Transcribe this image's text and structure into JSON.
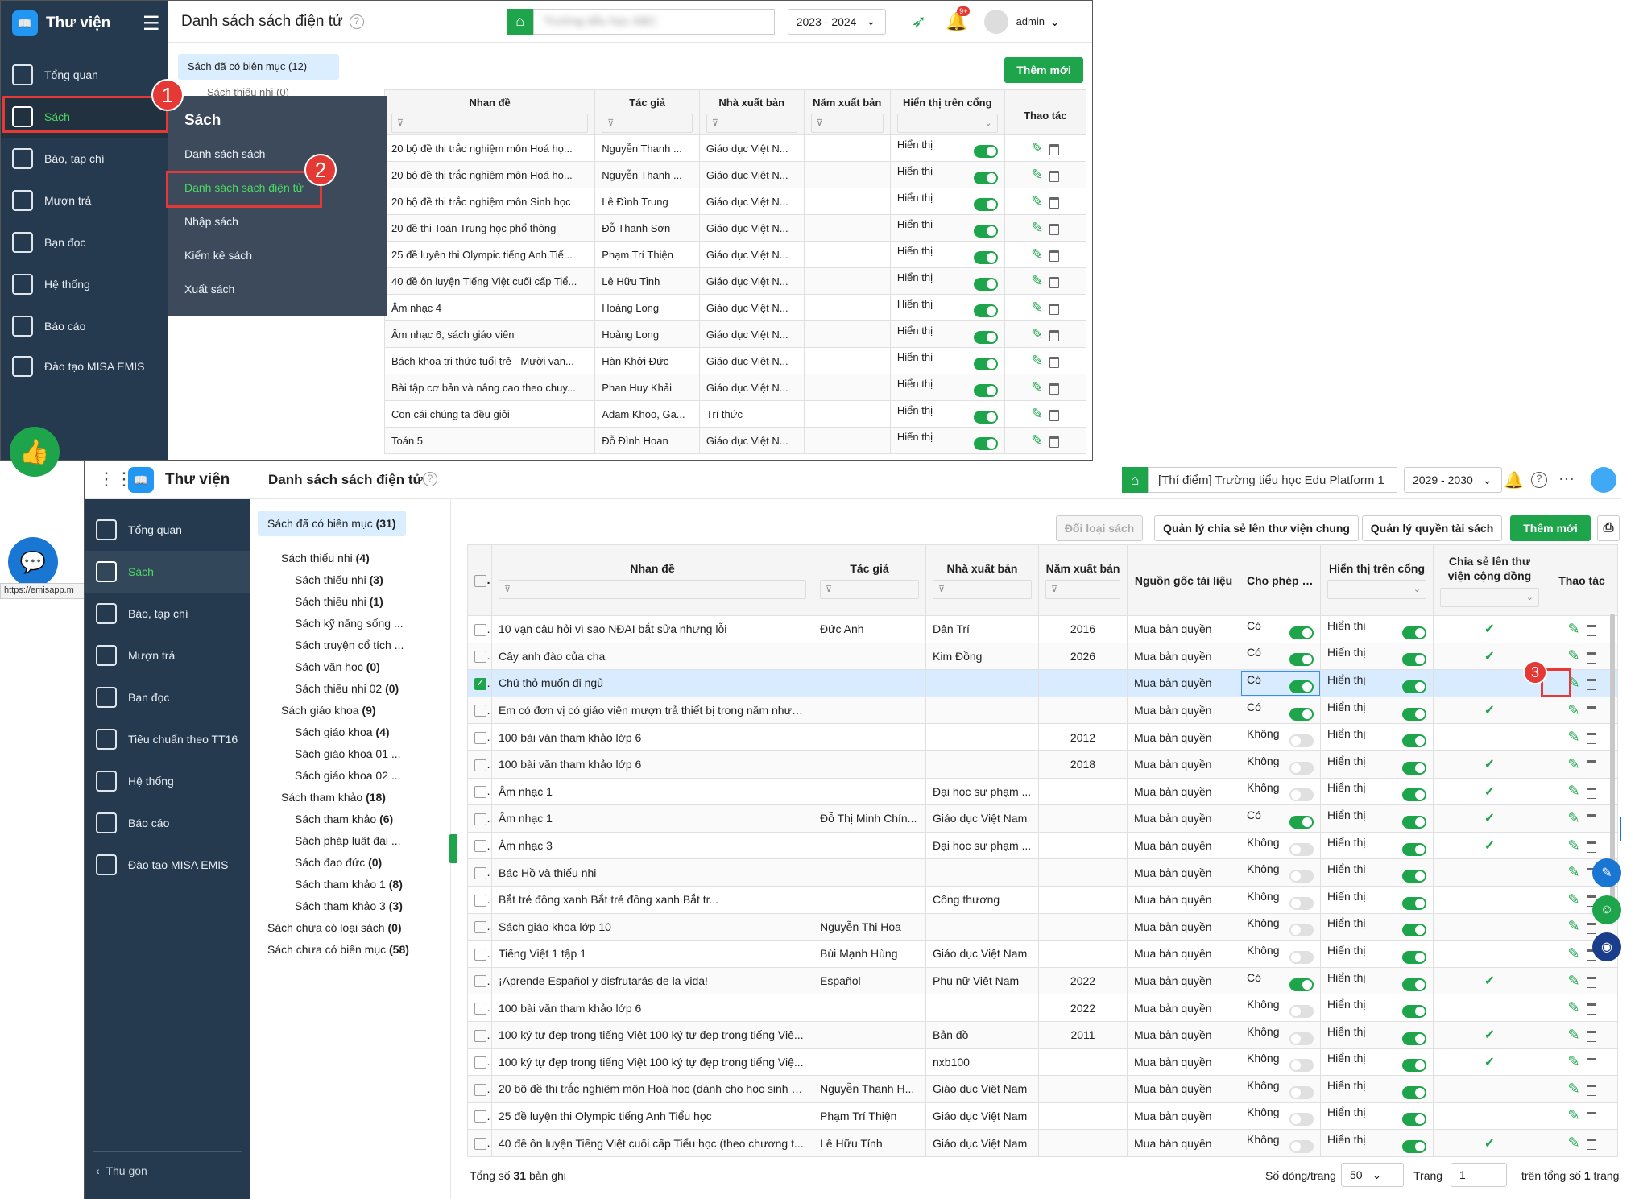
{
  "top": {
    "brand": "Thư viện",
    "page_title": "Danh sách sách điện tử",
    "year": "2023 - 2024",
    "notif_count": "9+",
    "user": "admin",
    "school_blurred": "Trường tiểu học ABC",
    "nav": [
      "Tổng quan",
      "Sách",
      "Báo, tạp chí",
      "Mượn trả",
      "Bạn đọc",
      "Hệ thống",
      "Báo cáo",
      "Đào tạo MISA EMIS"
    ],
    "flyout": {
      "header": "Sách",
      "items": [
        "Danh sách sách",
        "Danh sách sách điện tử",
        "Nhập sách",
        "Kiểm kê sách",
        "Xuất sách"
      ]
    },
    "tree_sel": "Sách đã có biên mục (12)",
    "tree_next": "Sách thiếu nhi (0)",
    "add_button": "Thêm mới",
    "columns": [
      "Nhan đề",
      "Tác giả",
      "Nhà xuất bản",
      "Năm xuất bản",
      "Hiển thị trên cổng",
      "Thao tác"
    ],
    "rows": [
      [
        "20 bộ đề thi trắc nghiệm môn Hoá họ...",
        "Nguyễn Thanh ...",
        "Giáo dục Việt N...",
        "",
        "Hiển thị"
      ],
      [
        "20 bộ đề thi trắc nghiệm môn Hoá họ...",
        "Nguyễn Thanh ...",
        "Giáo dục Việt N...",
        "",
        "Hiển thị"
      ],
      [
        "20 bộ đề thi trắc nghiệm môn Sinh học",
        "Lê Đình Trung",
        "Giáo dục Việt N...",
        "",
        "Hiển thị"
      ],
      [
        "20 đề thi Toán Trung học phổ thông",
        "Đỗ Thanh Sơn",
        "Giáo dục Việt N...",
        "",
        "Hiển thị"
      ],
      [
        "25 đề luyện thi Olympic tiếng Anh Tiể...",
        "Phạm Trí Thiện",
        "Giáo dục Việt N...",
        "",
        "Hiển thị"
      ],
      [
        "40 đề ôn luyện Tiếng Việt cuối cấp Tiể...",
        "Lê Hữu Tỉnh",
        "Giáo dục Việt N...",
        "",
        "Hiển thị"
      ],
      [
        "Âm nhạc 4",
        "Hoàng Long",
        "Giáo dục Việt N...",
        "",
        "Hiển thị"
      ],
      [
        "Âm nhạc 6, sách giáo viên",
        "Hoàng Long",
        "Giáo dục Việt N...",
        "",
        "Hiển thị"
      ],
      [
        "Bách khoa tri thức tuổi trẻ - Mười vạn...",
        "Hàn Khởi Đức",
        "Giáo dục Việt N...",
        "",
        "Hiển thị"
      ],
      [
        "Bài tập cơ bản và nâng cao theo chuy...",
        "Phan Huy Khải",
        "Giáo dục Việt N...",
        "",
        "Hiển thị"
      ],
      [
        "Con cái chúng ta đều giỏi",
        "Adam Khoo, Ga...",
        "Trí thức",
        "",
        "Hiển thị"
      ],
      [
        "Toán 5",
        "Đỗ Đình Hoan",
        "Giáo dục Việt N...",
        "",
        "Hiển thị"
      ]
    ],
    "url_hint": "https://emisapp.m"
  },
  "bottom": {
    "brand": "Thư viện",
    "page_title": "Danh sách sách điện tử",
    "school": "[Thí điểm] Trường tiểu học Edu Platform 1",
    "year": "2029 - 2030",
    "nav": [
      "Tổng quan",
      "Sách",
      "Báo, tạp chí",
      "Mượn trả",
      "Bạn đọc",
      "Tiêu chuẩn theo TT16",
      "Hệ thống",
      "Báo cáo",
      "Đào tạo MISA EMIS"
    ],
    "collapse": "Thu gọn",
    "tree": [
      {
        "label": "Sách đã có biên mục",
        "count": "(31)"
      },
      {
        "label": "Sách thiếu nhi",
        "count": "(4)"
      },
      {
        "label": "Sách thiếu nhi",
        "count": "(3)"
      },
      {
        "label": "Sách thiếu nhi",
        "count": "(1)"
      },
      {
        "label": "Sách kỹ năng sống ...",
        "count": ""
      },
      {
        "label": "Sách truyện cổ tích ...",
        "count": ""
      },
      {
        "label": "Sách văn học",
        "count": "(0)"
      },
      {
        "label": "Sách thiếu nhi 02",
        "count": "(0)"
      },
      {
        "label": "Sách giáo khoa",
        "count": "(9)"
      },
      {
        "label": "Sách giáo khoa",
        "count": "(4)"
      },
      {
        "label": "Sách giáo khoa 01 ...",
        "count": ""
      },
      {
        "label": "Sách giáo khoa 02 ...",
        "count": ""
      },
      {
        "label": "Sách tham khảo",
        "count": "(18)"
      },
      {
        "label": "Sách tham khảo",
        "count": "(6)"
      },
      {
        "label": "Sách pháp luật đại ...",
        "count": ""
      },
      {
        "label": "Sách đạo đức",
        "count": "(0)"
      },
      {
        "label": "Sách tham khảo 1",
        "count": "(8)"
      },
      {
        "label": "Sách tham khảo 3",
        "count": "(3)"
      },
      {
        "label": "Sách chưa có loại sách",
        "count": "(0)"
      },
      {
        "label": "Sách chưa có biên mục",
        "count": "(58)"
      }
    ],
    "buttons": {
      "change_type": "Đổi loại sách",
      "share_manage": "Quản lý chia sẻ lên thư viện chung",
      "rights_manage": "Quản lý quyền tài sách",
      "add": "Thêm mới"
    },
    "columns": [
      "Nhan đề",
      "Tác giả",
      "Nhà xuất bản",
      "Năm xuất bản",
      "Nguồn gốc tài liệu",
      "Cho phép tải",
      "Hiển thị trên cổng",
      "Chia sẻ lên thư viện cộng đồng",
      "Thao tác"
    ],
    "rows": [
      {
        "title": "10 vạn câu hỏi vì sao NĐAI bắt sửa nhưng lỗi",
        "author": "Đức Anh",
        "pub": "Dân Trí",
        "year": "2016",
        "src": "Mua bản quyền",
        "dl": "Có",
        "dl_on": true,
        "show": "Hiển thị",
        "share": true,
        "checked": false
      },
      {
        "title": "Cây anh đào của cha",
        "author": "",
        "pub": "Kim Đồng",
        "year": "2026",
        "src": "Mua bản quyền",
        "dl": "Có",
        "dl_on": true,
        "show": "Hiển thị",
        "share": true,
        "checked": false
      },
      {
        "title": "Chú thỏ muốn đi ngủ",
        "author": "",
        "pub": "",
        "year": "",
        "src": "Mua bản quyền",
        "dl": "Có",
        "dl_on": true,
        "show": "Hiển thị",
        "share": false,
        "checked": true
      },
      {
        "title": "Em có đơn vị có giáo viên mượn trả thiết bị trong năm nhưng...",
        "author": "",
        "pub": "",
        "year": "",
        "src": "Mua bản quyền",
        "dl": "Có",
        "dl_on": true,
        "show": "Hiển thị",
        "share": true,
        "checked": false
      },
      {
        "title": "100 bài văn tham khảo lớp 6",
        "author": "",
        "pub": "",
        "year": "2012",
        "src": "Mua bản quyền",
        "dl": "Không",
        "dl_on": false,
        "show": "Hiển thị",
        "share": false,
        "checked": false
      },
      {
        "title": "100 bài văn tham khảo lớp 6",
        "author": "",
        "pub": "",
        "year": "2018",
        "src": "Mua bản quyền",
        "dl": "Không",
        "dl_on": false,
        "show": "Hiển thị",
        "share": true,
        "checked": false
      },
      {
        "title": "Âm nhạc 1",
        "author": "",
        "pub": "Đại học sư phạm ...",
        "year": "",
        "src": "Mua bản quyền",
        "dl": "Không",
        "dl_on": false,
        "show": "Hiển thị",
        "share": true,
        "checked": false
      },
      {
        "title": "Âm nhạc 1",
        "author": "Đỗ Thị Minh Chín...",
        "pub": "Giáo dục Việt Nam",
        "year": "",
        "src": "Mua bản quyền",
        "dl": "Có",
        "dl_on": true,
        "show": "Hiển thị",
        "share": true,
        "checked": false
      },
      {
        "title": "Âm nhạc 3",
        "author": "",
        "pub": "Đại học sư phạm ...",
        "year": "",
        "src": "Mua bản quyền",
        "dl": "Không",
        "dl_on": false,
        "show": "Hiển thị",
        "share": true,
        "checked": false
      },
      {
        "title": "Bác Hồ và thiếu nhi",
        "author": "",
        "pub": "",
        "year": "",
        "src": "Mua bản quyền",
        "dl": "Không",
        "dl_on": false,
        "show": "Hiển thị",
        "share": false,
        "checked": false
      },
      {
        "title": "Bắt trẻ đồng xanh Bắt trẻ đồng xanh Bắt tr...",
        "author": "",
        "pub": "Công thương",
        "year": "",
        "src": "Mua bản quyền",
        "dl": "Không",
        "dl_on": false,
        "show": "Hiển thị",
        "share": false,
        "checked": false
      },
      {
        "title": "Sách giáo khoa lớp 10",
        "author": "Nguyễn Thị Hoa",
        "pub": "",
        "year": "",
        "src": "Mua bản quyền",
        "dl": "Không",
        "dl_on": false,
        "show": "Hiển thị",
        "share": false,
        "checked": false
      },
      {
        "title": "Tiếng Việt 1 tập 1",
        "author": "Bùi Mạnh Hùng",
        "pub": "Giáo dục Việt Nam",
        "year": "",
        "src": "Mua bản quyền",
        "dl": "Không",
        "dl_on": false,
        "show": "Hiển thị",
        "share": false,
        "checked": false
      },
      {
        "title": "¡Aprende Español y disfrutarás de la vida!",
        "author": "Español",
        "pub": "Phụ nữ Việt Nam",
        "year": "2022",
        "src": "Mua bản quyền",
        "dl": "Có",
        "dl_on": true,
        "show": "Hiển thị",
        "share": true,
        "checked": false
      },
      {
        "title": "100 bài văn tham khảo lớp 6",
        "author": "",
        "pub": "",
        "year": "2022",
        "src": "Mua bản quyền",
        "dl": "Không",
        "dl_on": false,
        "show": "Hiển thị",
        "share": false,
        "checked": false
      },
      {
        "title": "100 ký tự đẹp trong tiếng Việt 100 ký tự đẹp trong tiếng Việ...",
        "author": "",
        "pub": "Bản đồ",
        "year": "2011",
        "src": "Mua bản quyền",
        "dl": "Không",
        "dl_on": false,
        "show": "Hiển thị",
        "share": true,
        "checked": false
      },
      {
        "title": "100 ký tự đẹp trong tiếng Việt 100 ký tự đẹp trong tiếng Việ...",
        "author": "",
        "pub": "nxb100",
        "year": "",
        "src": "Mua bản quyền",
        "dl": "Không",
        "dl_on": false,
        "show": "Hiển thị",
        "share": true,
        "checked": false
      },
      {
        "title": "20 bộ đề thi trắc nghiệm môn Hoá học (dành cho học sinh ô...",
        "author": "Nguyễn Thanh H...",
        "pub": "Giáo dục Việt Nam",
        "year": "",
        "src": "Mua bản quyền",
        "dl": "Không",
        "dl_on": false,
        "show": "Hiển thị",
        "share": false,
        "checked": false
      },
      {
        "title": "25 đề luyện thi Olympic tiếng Anh Tiểu học",
        "author": "Phạm Trí Thiện",
        "pub": "Giáo dục Việt Nam",
        "year": "",
        "src": "Mua bản quyền",
        "dl": "Không",
        "dl_on": false,
        "show": "Hiển thị",
        "share": false,
        "checked": false
      },
      {
        "title": "40 đề ôn luyện Tiếng Việt cuối cấp Tiểu học (theo chương t...",
        "author": "Lê Hữu Tỉnh",
        "pub": "Giáo dục Việt Nam",
        "year": "",
        "src": "Mua bản quyền",
        "dl": "Không",
        "dl_on": false,
        "show": "Hiển thị",
        "share": true,
        "checked": false
      }
    ],
    "footer": {
      "total_label": "Tổng số",
      "total": "31",
      "total_suffix": "bản ghi",
      "rows_per_page_label": "Số dòng/trang",
      "rows_per_page": "50",
      "page_label": "Trang",
      "page": "1",
      "of_label": "trên tổng số",
      "pages": "1",
      "pages_suffix": "trang"
    }
  },
  "callouts": [
    "1",
    "2",
    "3"
  ],
  "colors": {
    "sidebar": "#263a4f",
    "accent": "#1ea54c",
    "callout": "#e53935"
  }
}
